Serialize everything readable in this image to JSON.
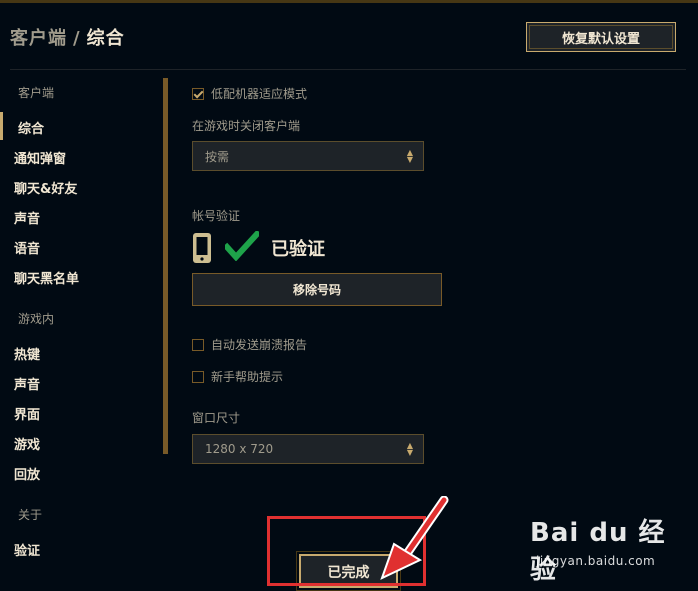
{
  "header": {
    "breadcrumb_root": "客户端",
    "separator": "/",
    "breadcrumb_current": "综合",
    "restore_defaults_label": "恢复默认设置"
  },
  "sidebar": {
    "section_client": "客户端",
    "client_items": [
      "综合",
      "通知弹窗",
      "聊天&好友",
      "声音",
      "语音",
      "聊天黑名单"
    ],
    "section_ingame": "游戏内",
    "ingame_items": [
      "热键",
      "声音",
      "界面",
      "游戏",
      "回放"
    ],
    "section_about": "关于",
    "about_items": [
      "验证"
    ],
    "active_item": "综合"
  },
  "main": {
    "low_spec_mode_label": "低配机器适应模式",
    "low_spec_mode_checked": true,
    "close_client_label": "在游戏时关闭客户端",
    "close_client_value": "按需",
    "account_verification_label": "帐号验证",
    "verified_text": "已验证",
    "remove_number_label": "移除号码",
    "crash_report_label": "自动发送崩溃报告",
    "crash_report_checked": false,
    "newbie_tips_label": "新手帮助提示",
    "newbie_tips_checked": false,
    "window_size_label": "窗口尺寸",
    "window_size_value": "1280 x 720"
  },
  "footer": {
    "done_label": "已完成"
  },
  "watermark": {
    "brand": "Bai du 经验",
    "url": "jingyan.baidu.com"
  },
  "colors": {
    "background": "#010a13",
    "gold": "#c8aa6e",
    "gold_dark": "#785a28",
    "text_light": "#f0e6d2",
    "text_muted": "#a09b8c",
    "verified_green": "#1ea34a",
    "annotation_red": "#e03030"
  }
}
